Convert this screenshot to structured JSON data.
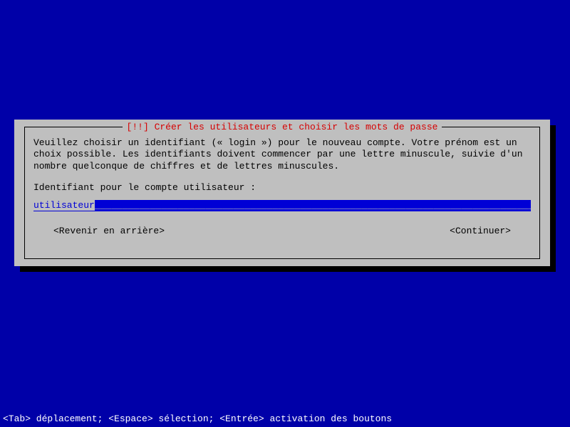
{
  "dialog": {
    "title_bangs": "[!!]",
    "title": "Créer les utilisateurs et choisir les mots de passe",
    "description": "Veuillez choisir un identifiant (« login ») pour le nouveau compte. Votre prénom est un choix possible. Les identifiants doivent commencer par une lettre minuscule, suivie d'un nombre quelconque de chiffres et de lettres minuscules.",
    "prompt": "Identifiant pour le compte utilisateur :",
    "input_value": "utilisateur",
    "back_label": "<Revenir en arrière>",
    "continue_label": "<Continuer>"
  },
  "footer": {
    "help": "<Tab> déplacement; <Espace> sélection; <Entrée> activation des boutons"
  }
}
